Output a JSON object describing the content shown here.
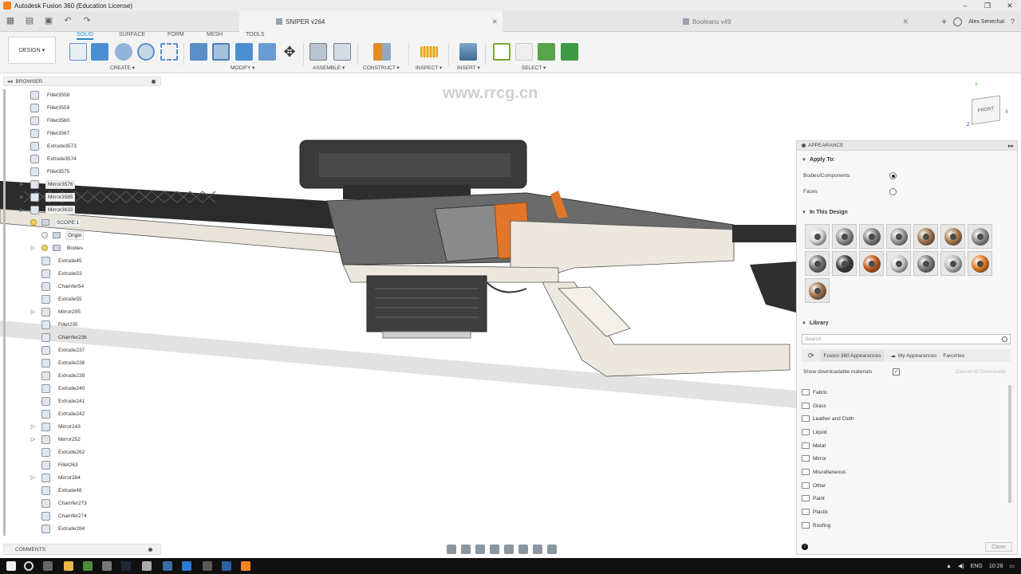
{
  "window": {
    "title": "Autodesk Fusion 360 (Education License)"
  },
  "tabs": {
    "active": "SNIPER v264",
    "inactive": "Booleans v49",
    "user": "Alex Senechal"
  },
  "watermark": "www.rrcg.cn",
  "toolbar": {
    "workspace": "DESIGN ▾",
    "workspace_tabs": [
      "SOLID",
      "SURFACE",
      "FORM",
      "MESH",
      "TOOLS"
    ],
    "groups": [
      "CREATE ▾",
      "MODIFY ▾",
      "ASSEMBLE ▾",
      "CONSTRUCT ▾",
      "INSPECT ▾",
      "INSERT ▾",
      "SELECT ▾"
    ]
  },
  "browser": {
    "title": "BROWSER",
    "items": [
      "Fillet3558",
      "Fillet3559",
      "Fillet3560",
      "Fillet3567",
      "Extrude3573",
      "Extrude3574",
      "Fillet3575",
      "Mirror3576",
      "Mirror3585",
      "Mirror3633",
      "SCOPE:1",
      "Origin",
      "Bodies",
      "Extrude45",
      "Extrude53",
      "Chamfer54",
      "Extrude55",
      "Mirror205",
      "Fillet235",
      "Chamfer236",
      "Extrude237",
      "Extrude238",
      "Extrude239",
      "Extrude240",
      "Extrude241",
      "Extrude242",
      "Mirror243",
      "Mirror252",
      "Extrude262",
      "Fillet263",
      "Mirror264",
      "Extrude48",
      "Chamfer273",
      "Chamfer274",
      "Extrude284"
    ],
    "comments": "COMMENTS"
  },
  "viewcube": {
    "face": "FRONT"
  },
  "appearance": {
    "title": "APPEARANCE",
    "apply_to": "Apply To:",
    "bodies": "Bodies/Components",
    "faces": "Faces",
    "in_design": "In This Design",
    "library": "Library",
    "search_placeholder": "Search",
    "lib_tabs": [
      "Fusion 360 Appearances",
      "My Appearances",
      "Favorites"
    ],
    "show_downloadable": "Show downloadable materials",
    "cancel_downloads": "Cancel All Downloads",
    "categories": [
      "Fabric",
      "Glass",
      "Leather and Cloth",
      "Liquid",
      "Metal",
      "Mirror",
      "Miscellaneous",
      "Other",
      "Paint",
      "Plastic",
      "Roofing"
    ],
    "close": "Close",
    "swatch_colors": [
      "#d9d9d9",
      "#8a8a8a",
      "#7d7d7d",
      "#9a9a9a",
      "#a0724a",
      "#a8774a",
      "#8f8f8f",
      "#6f6f6f",
      "#3a3a3a",
      "#c45a1c",
      "#c8c8c8",
      "#7a7a7a",
      "#b8b8b8",
      "#e07a20",
      "#a0724a"
    ]
  },
  "taskbar": {
    "lang": "ENG",
    "time": "10:28"
  }
}
